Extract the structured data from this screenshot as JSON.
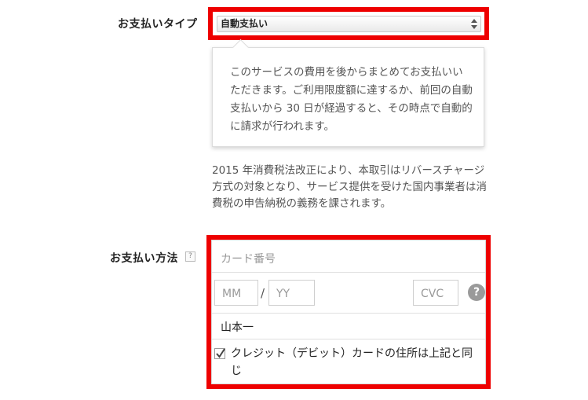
{
  "payment_type": {
    "label": "お支払いタイプ",
    "selected": "自動支払い",
    "select_icon": "up-down-arrows-icon",
    "tooltip": "このサービスの費用を後からまとめてお支払いいただきます。ご利用限度額に達するか、前回の自動支払いから 30 日が経過すると、その時点で自動的に請求が行われます。"
  },
  "tax_note": "2015 年消費税法改正により、本取引はリバースチャージ方式の対象となり、サービス提供を受けた国内事業者は消費税の申告納税の義務を課されます。",
  "payment_method": {
    "label": "お支払い方法",
    "help_icon": "?",
    "card_number_placeholder": "カード番号",
    "mm_placeholder": "MM",
    "separator": "/",
    "yy_placeholder": "YY",
    "cvc_placeholder": "CVC",
    "cvc_help_icon": "?",
    "cardholder_name": "山本一",
    "same_address_checked": true,
    "same_address_label": "クレジット（デビット）カードの住所は上記と同じ"
  },
  "colors": {
    "highlight": "#ee0000",
    "text": "#555555"
  }
}
